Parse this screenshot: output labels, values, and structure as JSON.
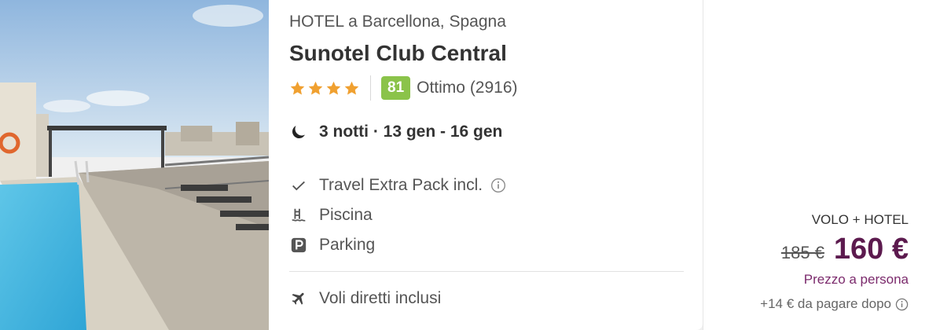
{
  "hotel": {
    "location": "HOTEL a Barcellona, Spagna",
    "name": "Sunotel Club Central",
    "stars": 4,
    "score": "81",
    "score_label": "Ottimo (2916)",
    "score_color": "#8bc34a",
    "star_color": "#f0a030"
  },
  "stay": {
    "dates": "3 notti · 13 gen - 16 gen",
    "icon": "moon-icon"
  },
  "features": [
    {
      "label": "Travel Extra Pack incl.",
      "icon": "check-icon",
      "has_info": true
    },
    {
      "label": "Piscina",
      "icon": "pool-icon"
    },
    {
      "label": "Parking",
      "icon": "parking-icon"
    }
  ],
  "flights": {
    "label": "Voli diretti inclusi",
    "icon": "plane-icon"
  },
  "pricing": {
    "package": "VOLO + HOTEL",
    "old_price": "185 €",
    "price": "160 €",
    "per_person": "Prezzo a persona",
    "extra": "+14 € da pagare dopo",
    "price_color": "#5c1a4e"
  },
  "image": {
    "alt_icon": "hotel-photo"
  }
}
